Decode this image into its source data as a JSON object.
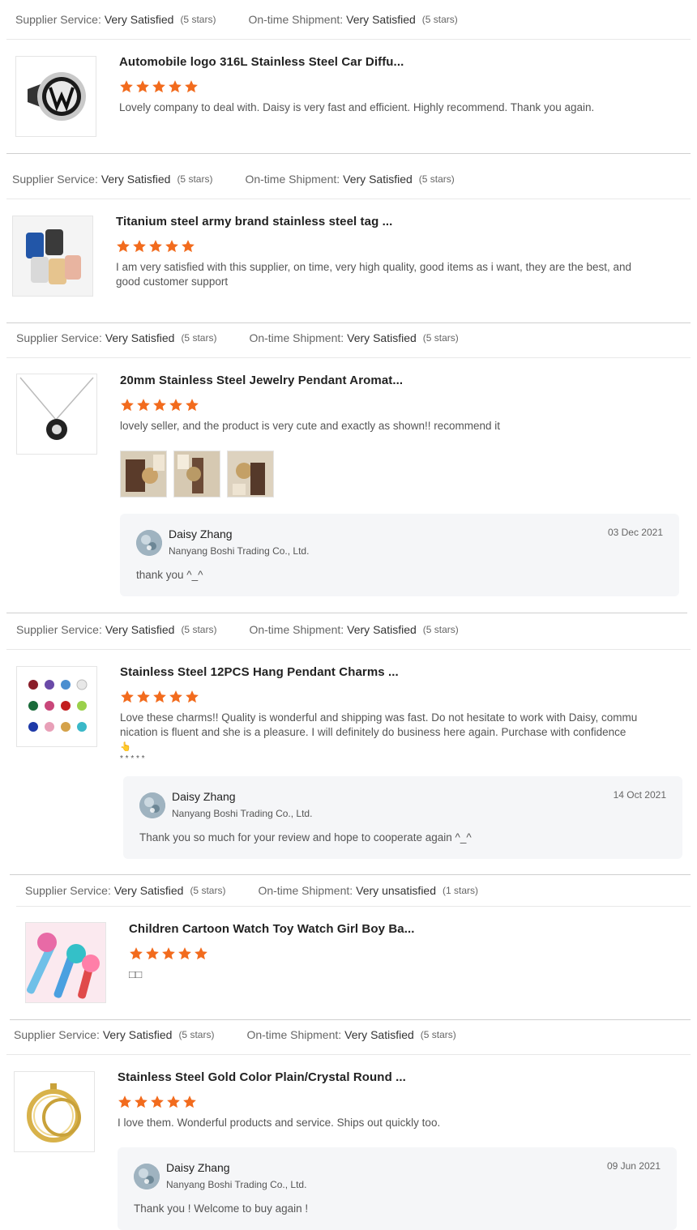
{
  "labels": {
    "supplier_service": "Supplier Service:",
    "ontime_shipment": "On-time Shipment:"
  },
  "star_color": "#f26b1d",
  "reviews": [
    {
      "supplier_rating": "Very Satisfied",
      "supplier_count": "(5 stars)",
      "shipment_rating": "Very Satisfied",
      "shipment_count": "(5 stars)",
      "product_title": "Automobile logo 316L Stainless Steel Car Diffu...",
      "stars": 5,
      "text": "Lovely company to deal with. Daisy is very fast and efficient. Highly recommend. Thank you again."
    },
    {
      "supplier_rating": "Very Satisfied",
      "supplier_count": "(5 stars)",
      "shipment_rating": "Very Satisfied",
      "shipment_count": "(5 stars)",
      "product_title": "Titanium steel army brand stainless steel tag ...",
      "stars": 5,
      "text_line1": "I am very satisfied with this supplier, on time, very high quality, good items as i want, they are the best, and",
      "text_line2": "good customer support"
    },
    {
      "supplier_rating": "Very Satisfied",
      "supplier_count": "(5 stars)",
      "shipment_rating": "Very Satisfied",
      "shipment_count": "(5 stars)",
      "product_title": "20mm Stainless Steel Jewelry Pendant Aromat...",
      "stars": 5,
      "text": "lovely seller, and the product is very cute and exactly as shown!! recommend it",
      "reply": {
        "name": "Daisy Zhang",
        "company": "Nanyang Boshi Trading Co., Ltd.",
        "date": "03 Dec 2021",
        "message": "thank you ^_^"
      }
    },
    {
      "supplier_rating": "Very Satisfied",
      "supplier_count": "(5 stars)",
      "shipment_rating": "Very Satisfied",
      "shipment_count": "(5 stars)",
      "product_title": "Stainless Steel 12PCS Hang Pendant Charms ...",
      "stars": 5,
      "text_line1": "Love these charms!! Quality is wonderful and shipping was fast. Do not hesitate to work with Daisy, commu",
      "text_line2": "nication is fluent and she is a pleasure. I will definitely do business here again. Purchase with confidence",
      "text_line3": "👆",
      "text_line4": "* * * * *",
      "reply": {
        "name": "Daisy Zhang",
        "company": "Nanyang Boshi Trading Co., Ltd.",
        "date": "14 Oct 2021",
        "message": "Thank you so much for your review and hope to cooperate again ^_^"
      }
    },
    {
      "supplier_rating": "Very Satisfied",
      "supplier_count": "(5 stars)",
      "shipment_rating": "Very unsatisfied",
      "shipment_count": "(1 stars)",
      "product_title": "Children Cartoon Watch Toy Watch Girl Boy Ba...",
      "stars": 5,
      "text": "□□"
    },
    {
      "supplier_rating": "Very Satisfied",
      "supplier_count": "(5 stars)",
      "shipment_rating": "Very Satisfied",
      "shipment_count": "(5 stars)",
      "product_title": "Stainless Steel Gold Color Plain/Crystal Round ...",
      "stars": 5,
      "text": "I love them. Wonderful products and service. Ships out quickly too.",
      "reply": {
        "name": "Daisy Zhang",
        "company": "Nanyang Boshi Trading Co., Ltd.",
        "date": "09 Jun 2021",
        "message": "Thank you !  Welcome to buy again !"
      }
    }
  ]
}
